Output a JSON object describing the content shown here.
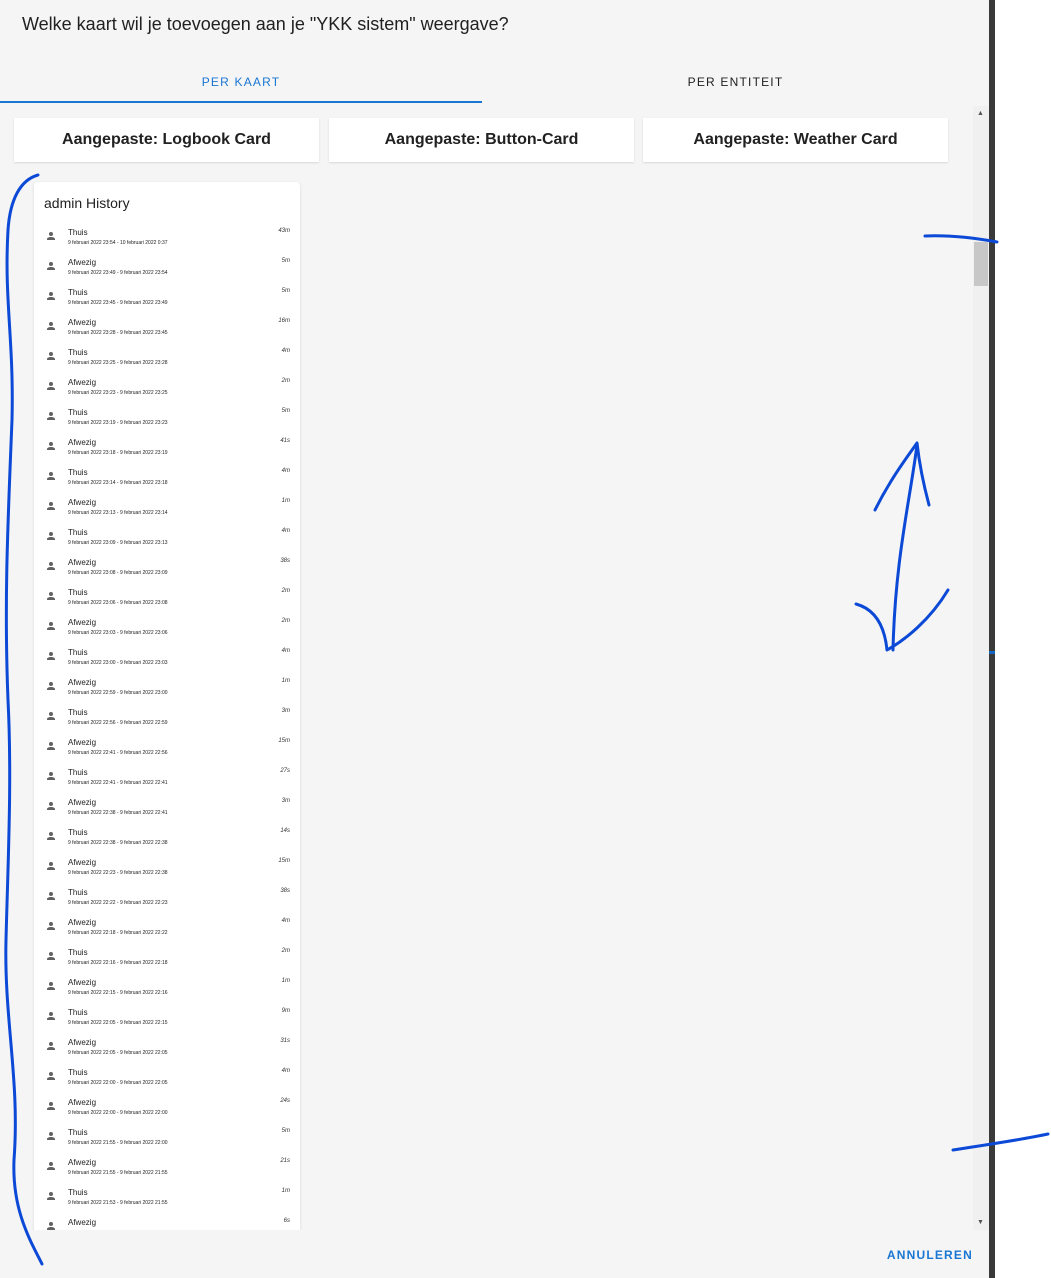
{
  "dialog": {
    "title": "Welke kaart wil je toevoegen aan je \"YKK sistem\" weergave?",
    "cancel_label": "ANNULEREN"
  },
  "tabs": [
    {
      "label": "PER KAART",
      "active": true
    },
    {
      "label": "PER ENTITEIT",
      "active": false
    }
  ],
  "cards": [
    {
      "label": "Aangepaste: Logbook Card"
    },
    {
      "label": "Aangepaste: Button-Card"
    },
    {
      "label": "Aangepaste: Weather Card"
    }
  ],
  "preview": {
    "title": "admin History",
    "icon": "account-icon",
    "entries": [
      {
        "state": "Thuis",
        "time": "9 februari 2022 23:54 - 10 februari 2022 0:37",
        "duration": "43m"
      },
      {
        "state": "Afwezig",
        "time": "9 februari 2022 23:49 - 9 februari 2022 23:54",
        "duration": "5m"
      },
      {
        "state": "Thuis",
        "time": "9 februari 2022 23:45 - 9 februari 2022 23:49",
        "duration": "5m"
      },
      {
        "state": "Afwezig",
        "time": "9 februari 2022 23:28 - 9 februari 2022 23:45",
        "duration": "16m"
      },
      {
        "state": "Thuis",
        "time": "9 februari 2022 23:25 - 9 februari 2022 23:28",
        "duration": "4m"
      },
      {
        "state": "Afwezig",
        "time": "9 februari 2022 23:23 - 9 februari 2022 23:25",
        "duration": "2m"
      },
      {
        "state": "Thuis",
        "time": "9 februari 2022 23:19 - 9 februari 2022 23:23",
        "duration": "5m"
      },
      {
        "state": "Afwezig",
        "time": "9 februari 2022 23:18 - 9 februari 2022 23:19",
        "duration": "41s"
      },
      {
        "state": "Thuis",
        "time": "9 februari 2022 23:14 - 9 februari 2022 23:18",
        "duration": "4m"
      },
      {
        "state": "Afwezig",
        "time": "9 februari 2022 23:13 - 9 februari 2022 23:14",
        "duration": "1m"
      },
      {
        "state": "Thuis",
        "time": "9 februari 2022 23:09 - 9 februari 2022 23:13",
        "duration": "4m"
      },
      {
        "state": "Afwezig",
        "time": "9 februari 2022 23:08 - 9 februari 2022 23:09",
        "duration": "38s"
      },
      {
        "state": "Thuis",
        "time": "9 februari 2022 23:06 - 9 februari 2022 23:08",
        "duration": "2m"
      },
      {
        "state": "Afwezig",
        "time": "9 februari 2022 23:03 - 9 februari 2022 23:06",
        "duration": "2m"
      },
      {
        "state": "Thuis",
        "time": "9 februari 2022 23:00 - 9 februari 2022 23:03",
        "duration": "4m"
      },
      {
        "state": "Afwezig",
        "time": "9 februari 2022 22:59 - 9 februari 2022 23:00",
        "duration": "1m"
      },
      {
        "state": "Thuis",
        "time": "9 februari 2022 22:56 - 9 februari 2022 22:59",
        "duration": "3m"
      },
      {
        "state": "Afwezig",
        "time": "9 februari 2022 22:41 - 9 februari 2022 22:56",
        "duration": "15m"
      },
      {
        "state": "Thuis",
        "time": "9 februari 2022 22:41 - 9 februari 2022 22:41",
        "duration": "27s"
      },
      {
        "state": "Afwezig",
        "time": "9 februari 2022 22:38 - 9 februari 2022 22:41",
        "duration": "3m"
      },
      {
        "state": "Thuis",
        "time": "9 februari 2022 22:38 - 9 februari 2022 22:38",
        "duration": "14s"
      },
      {
        "state": "Afwezig",
        "time": "9 februari 2022 22:23 - 9 februari 2022 22:38",
        "duration": "15m"
      },
      {
        "state": "Thuis",
        "time": "9 februari 2022 22:22 - 9 februari 2022 22:23",
        "duration": "38s"
      },
      {
        "state": "Afwezig",
        "time": "9 februari 2022 22:18 - 9 februari 2022 22:22",
        "duration": "4m"
      },
      {
        "state": "Thuis",
        "time": "9 februari 2022 22:16 - 9 februari 2022 22:18",
        "duration": "2m"
      },
      {
        "state": "Afwezig",
        "time": "9 februari 2022 22:15 - 9 februari 2022 22:16",
        "duration": "1m"
      },
      {
        "state": "Thuis",
        "time": "9 februari 2022 22:05 - 9 februari 2022 22:15",
        "duration": "9m"
      },
      {
        "state": "Afwezig",
        "time": "9 februari 2022 22:05 - 9 februari 2022 22:05",
        "duration": "31s"
      },
      {
        "state": "Thuis",
        "time": "9 februari 2022 22:00 - 9 februari 2022 22:05",
        "duration": "4m"
      },
      {
        "state": "Afwezig",
        "time": "9 februari 2022 22:00 - 9 februari 2022 22:00",
        "duration": "24s"
      },
      {
        "state": "Thuis",
        "time": "9 februari 2022 21:55 - 9 februari 2022 22:00",
        "duration": "5m"
      },
      {
        "state": "Afwezig",
        "time": "9 februari 2022 21:55 - 9 februari 2022 21:55",
        "duration": "21s"
      },
      {
        "state": "Thuis",
        "time": "9 februari 2022 21:53 - 9 februari 2022 21:55",
        "duration": "1m"
      },
      {
        "state": "Afwezig",
        "time": "",
        "duration": "6s"
      }
    ]
  },
  "scrollbar": {
    "up_icon": "scroll-up-arrow-icon",
    "down_icon": "scroll-down-arrow-icon"
  },
  "annotation_color": "#0b49d6",
  "accent_color": "#1976d2"
}
